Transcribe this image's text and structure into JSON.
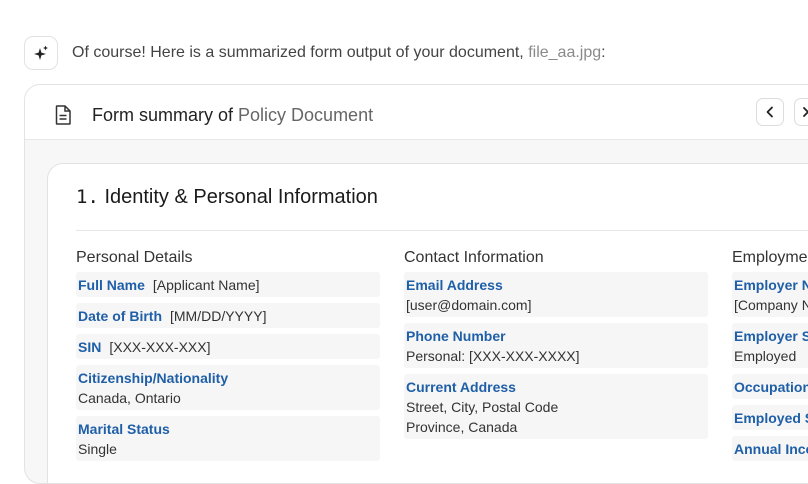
{
  "intro": {
    "text": "Of course! Here is a summarized form output of your document,",
    "filename": "file_aa.jpg",
    "suffix": ":"
  },
  "header": {
    "title_prefix": "Form summary of",
    "document_name": "Policy Document"
  },
  "section": {
    "number": "1.",
    "title": "Identity & Personal Information"
  },
  "columns": {
    "personal": {
      "heading": "Personal Details",
      "fields": [
        {
          "label": "Full Name",
          "value": "[Applicant Name]"
        },
        {
          "label": "Date of Birth",
          "value": "[MM/DD/YYYY]"
        },
        {
          "label": "SIN",
          "value": "[XXX-XXX-XXX]"
        },
        {
          "label": "Citizenship/Nationality",
          "value": "Canada, Ontario"
        },
        {
          "label": "Marital Status",
          "value": "Single"
        }
      ]
    },
    "contact": {
      "heading": "Contact Information",
      "fields": [
        {
          "label": "Email Address",
          "value": "[user@domain.com]"
        },
        {
          "label": "Phone Number",
          "value": "Personal: [XXX-XXX-XXXX]"
        },
        {
          "label": "Current Address",
          "value": "Street, City, Postal Code",
          "value2": "Province, Canada"
        }
      ]
    },
    "employment": {
      "heading": "Employme",
      "fields": [
        {
          "label": "Employer Na",
          "value": "[Company N"
        },
        {
          "label": "Employer St",
          "value": "Employed"
        },
        {
          "label": "Occupation",
          "value": ""
        },
        {
          "label": "Employed Si",
          "value": ""
        },
        {
          "label": "Annual Inco",
          "value": ""
        }
      ]
    }
  },
  "colors": {
    "label_blue": "#1f5fa8",
    "field_bg": "#f6f6f6",
    "panel_bg": "#f7f7f8"
  },
  "icons": {
    "assistant": "sparkle-icon",
    "document": "document-icon",
    "prev": "chevron-left-icon",
    "next": "close-icon"
  }
}
